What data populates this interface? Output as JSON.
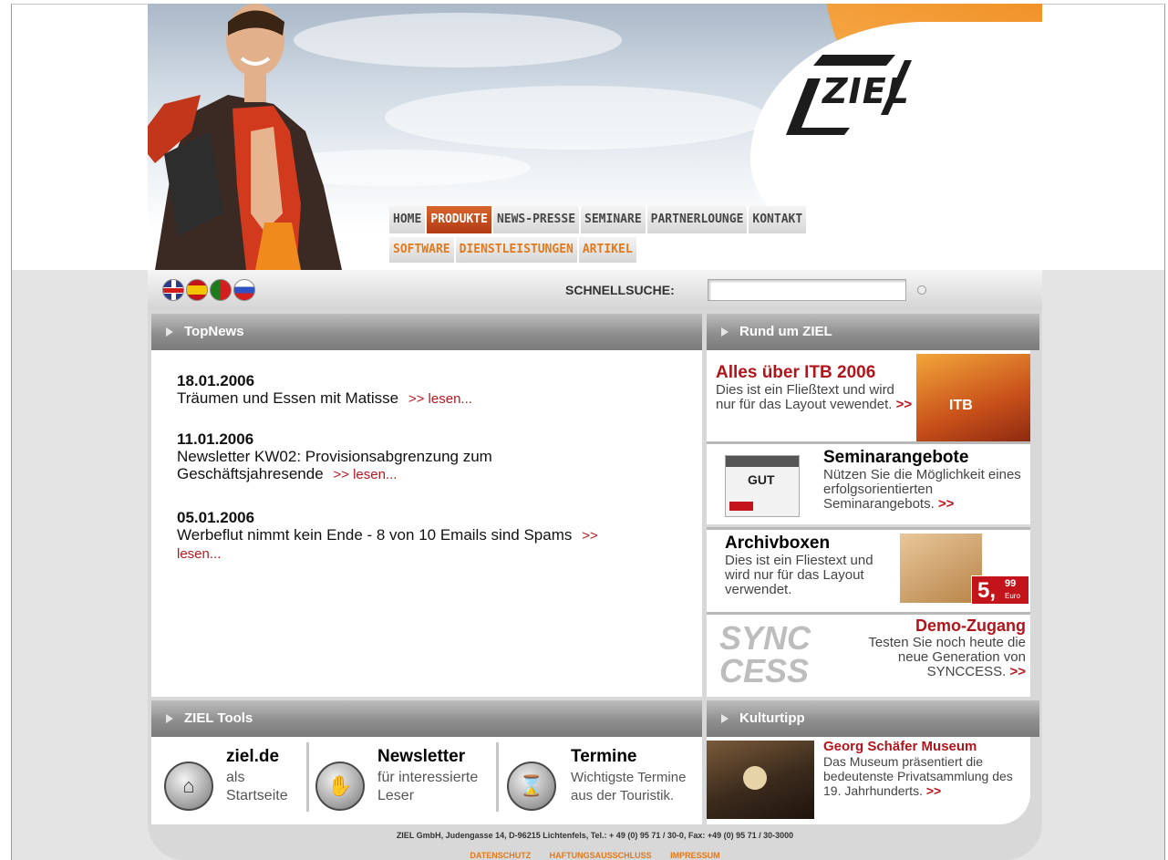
{
  "nav": {
    "items": [
      "HOME",
      "PRODUKTE",
      "NEWS-PRESSE",
      "SEMINARE",
      "PARTNERLOUNGE",
      "KONTAKT"
    ],
    "active": "PRODUKTE",
    "sub_items": [
      "SOFTWARE",
      "DIENSTLEISTUNGEN",
      "ARTIKEL"
    ]
  },
  "logo": {
    "text": "ZIEL"
  },
  "search": {
    "label": "SCHNELLSUCHE:",
    "value": ""
  },
  "flags": [
    "uk-flag",
    "spain-flag",
    "portugal-flag",
    "russia-flag"
  ],
  "topnews": {
    "heading": "TopNews",
    "items": [
      {
        "date": "18.01.2006",
        "text": "Träumen und Essen mit Matisse",
        "link": ">> lesen..."
      },
      {
        "date": "11.01.2006",
        "text": "Newsletter KW02: Provisionsabgrenzung zum Geschäftsjahresende",
        "link": ">> lesen..."
      },
      {
        "date": "05.01.2006",
        "text": "Werbeflut nimmt kein Ende - 8 von 10 Emails sind Spams",
        "link": ">> lesen..."
      }
    ]
  },
  "rund_um": {
    "heading": "Rund um ZIEL",
    "promos": [
      {
        "title": "Alles über ITB 2006",
        "text": "Dies ist ein Fließtext und wird nur für das Layout vewendet.",
        "link": ">>",
        "image_text": "ITB"
      },
      {
        "title": "Seminarangebote",
        "text": "Nützen Sie die Möglichkeit eines erfolgsorientierten Seminarangebots.",
        "link": ">>",
        "image_text": "GUT"
      },
      {
        "title": "Archivboxen",
        "text": "Dies ist ein Fliestext und wird nur für das Layout verwendet.",
        "link": "",
        "price_main": "5,",
        "price_cents": "99",
        "price_unit": "Euro"
      },
      {
        "title": "Demo-Zugang",
        "text": "Testen Sie noch heute die neue Generation von SYNCCESS.",
        "link": ">>",
        "image_text": "SYNC CESS"
      }
    ]
  },
  "tools": {
    "heading": "ZIEL Tools",
    "items": [
      {
        "title": "ziel.de",
        "text": "als Startseite",
        "icon": "home-icon"
      },
      {
        "title": "Newsletter",
        "text": "für interessierte Leser",
        "icon": "hand-icon"
      },
      {
        "title": "Termine",
        "text": "Wichtigste Termine aus der Touristik.",
        "icon": "hourglass-icon"
      }
    ]
  },
  "kultur": {
    "heading": "Kulturtipp",
    "title": "Georg Schäfer Museum",
    "text": "Das Museum präsentiert die bedeutenste Privatsammlung des 19. Jahrhunderts.",
    "link": ">>"
  },
  "footer": {
    "address": "ZIEL GmbH, Judengasse 14, D-96215 Lichtenfels, Tel.: + 49 (0) 95 71 / 30-0, Fax: +49 (0) 95 71 / 30-3000",
    "links": [
      "DATENSCHUTZ",
      "HAFTUNGSAUSSCHLUSS",
      "IMPRESSUM"
    ]
  },
  "colors": {
    "accent_red": "#b8171d",
    "accent_orange": "#e07a1c",
    "header_gray": "#8f8f8f"
  }
}
